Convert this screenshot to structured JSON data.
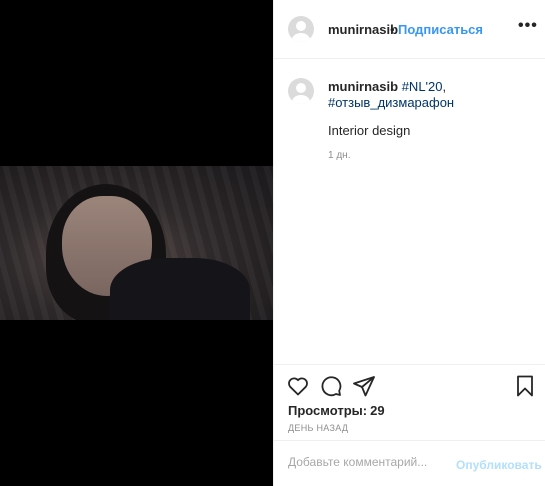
{
  "post": {
    "username": "munirnasib",
    "dot": "•",
    "follow_label": "Подписаться",
    "more_label": "•••"
  },
  "caption": {
    "username": "munirnasib",
    "tag1": "#NL'20",
    "separator": ",",
    "tag2": "#отзыв_дизмарафон",
    "text": "Interior design",
    "age": "1 дн."
  },
  "actions": {
    "icons": [
      "heart-icon",
      "comment-icon",
      "share-icon",
      "bookmark-icon"
    ],
    "views_label": "Просмотры:",
    "views_count": "29",
    "timestamp": "ДЕНЬ НАЗАД"
  },
  "add_comment": {
    "placeholder": "Добавьте комментарий...",
    "publish_label": "Опубликовать"
  },
  "colors": {
    "accent": "#3897f0",
    "hashtag": "#003569",
    "muted": "#8e8e8e",
    "publish_disabled": "#b2dffc"
  }
}
